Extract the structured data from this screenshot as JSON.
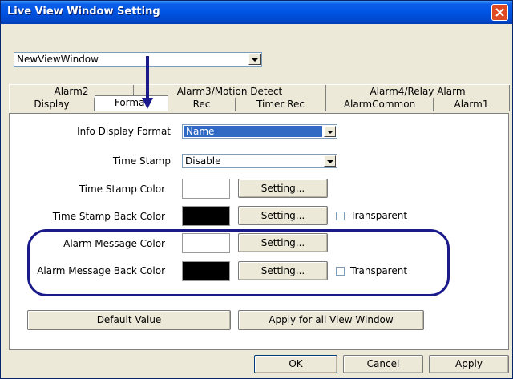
{
  "window": {
    "title": "Live View Window Setting",
    "title_color": "#0054e3",
    "close_icon": "close-icon"
  },
  "view_select": {
    "value": "NewViewWindow"
  },
  "tabs": {
    "back_row": [
      "Alarm2",
      "Alarm3/Motion Detect",
      "Alarm4/Relay Alarm"
    ],
    "front_row": [
      "Display",
      "Format",
      "Rec",
      "Timer Rec",
      "AlarmCommon",
      "Alarm1"
    ],
    "active": "Format"
  },
  "format": {
    "info_display_format": {
      "label": "Info Display Format",
      "value": "Name"
    },
    "time_stamp": {
      "label": "Time Stamp",
      "value": "Disable"
    },
    "time_stamp_color": {
      "label": "Time Stamp Color",
      "swatch": "#ffffff",
      "button": "Setting..."
    },
    "time_stamp_back_color": {
      "label": "Time Stamp Back Color",
      "swatch": "#000000",
      "button": "Setting...",
      "transparent_label": "Transparent",
      "transparent_checked": false
    },
    "alarm_message_color": {
      "label": "Alarm Message Color",
      "swatch": "#ffffff",
      "button": "Setting..."
    },
    "alarm_message_back_color": {
      "label": "Alarm Message Back Color",
      "swatch": "#000000",
      "button": "Setting...",
      "transparent_label": "Transparent",
      "transparent_checked": false
    },
    "default_value_button": "Default Value",
    "apply_all_button": "Apply for all View Window"
  },
  "footer": {
    "ok": "OK",
    "cancel": "Cancel",
    "apply": "Apply"
  },
  "colors": {
    "highlight": "#1a1a8a",
    "selection": "#316ac5"
  }
}
